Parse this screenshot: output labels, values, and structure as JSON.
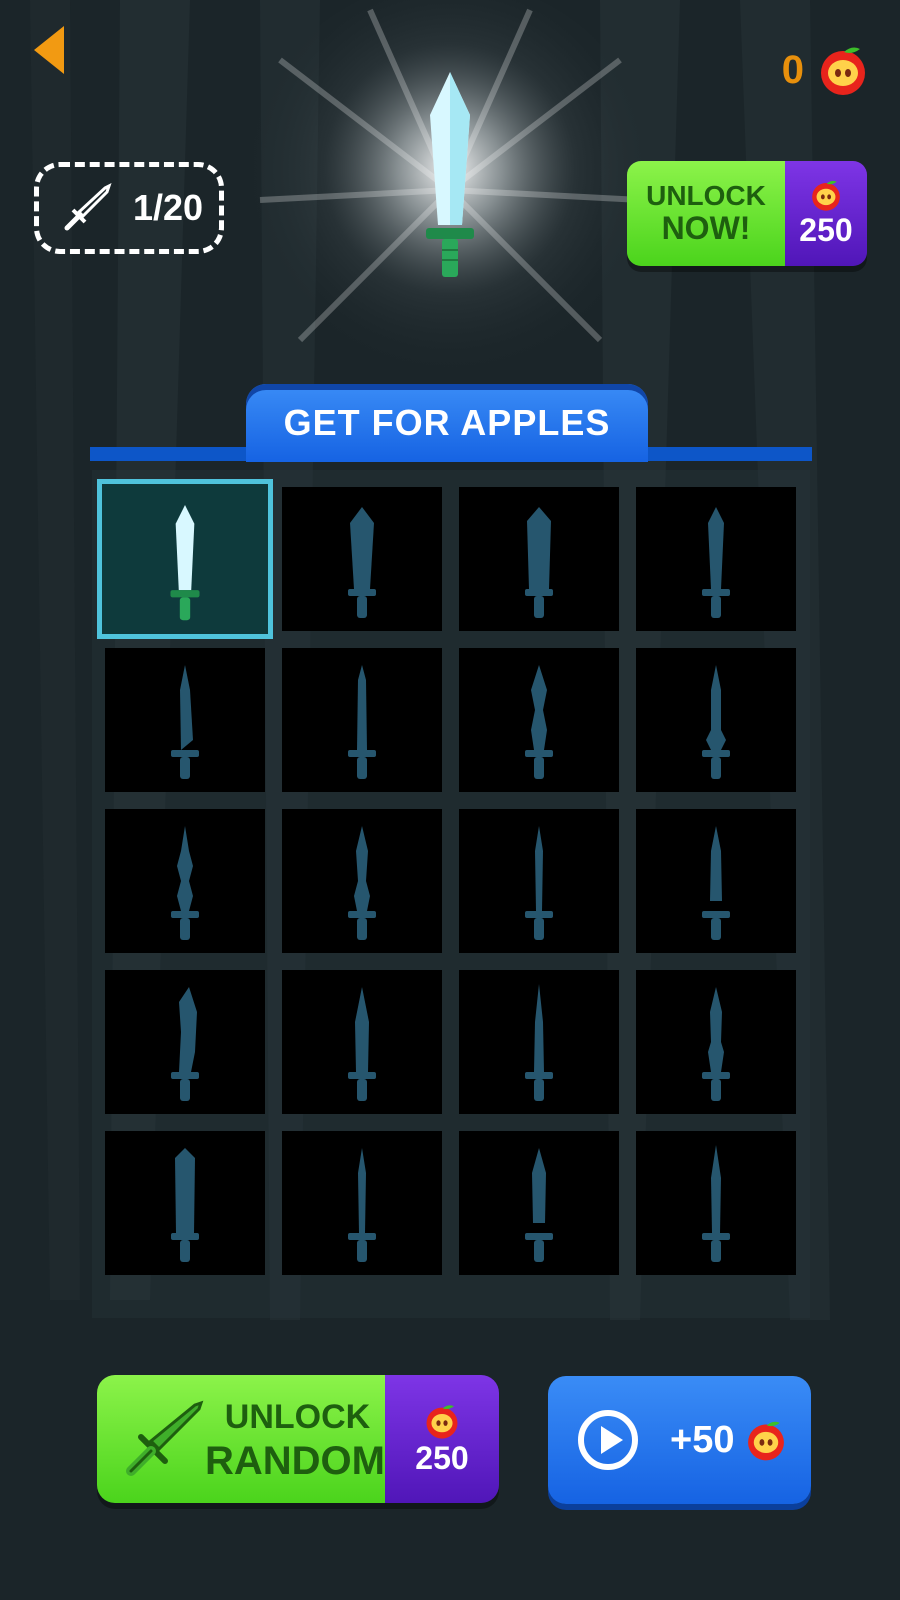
{
  "header": {
    "back_icon": "back-arrow-icon",
    "apple_count": "0",
    "apple_icon": "apple-icon"
  },
  "collection": {
    "progress_text": "1/20",
    "icon": "sword-icon"
  },
  "unlock_now": {
    "label_line1": "UNLOCK",
    "label_line2": "NOW!",
    "price": "250"
  },
  "section": {
    "title": "GET FOR APPLES"
  },
  "grid": {
    "selected_index": 0,
    "items": [
      {
        "type": "knife-classic",
        "unlocked": true
      },
      {
        "type": "knife-wide",
        "unlocked": false
      },
      {
        "type": "knife-cleaver",
        "unlocked": false
      },
      {
        "type": "knife-slim",
        "unlocked": false
      },
      {
        "type": "knife-curved-tip",
        "unlocked": false
      },
      {
        "type": "knife-serrated",
        "unlocked": false
      },
      {
        "type": "knife-diamond",
        "unlocked": false
      },
      {
        "type": "knife-bulb",
        "unlocked": false
      },
      {
        "type": "knife-ornate",
        "unlocked": false
      },
      {
        "type": "knife-dagger",
        "unlocked": false
      },
      {
        "type": "knife-saw",
        "unlocked": false
      },
      {
        "type": "knife-stiletto",
        "unlocked": false
      },
      {
        "type": "knife-scimitar",
        "unlocked": false
      },
      {
        "type": "knife-spike",
        "unlocked": false
      },
      {
        "type": "knife-needle",
        "unlocked": false
      },
      {
        "type": "knife-kris",
        "unlocked": false
      },
      {
        "type": "knife-broad",
        "unlocked": false
      },
      {
        "type": "knife-rapier",
        "unlocked": false
      },
      {
        "type": "knife-spear",
        "unlocked": false
      },
      {
        "type": "knife-thin",
        "unlocked": false
      }
    ]
  },
  "unlock_random": {
    "label_line1": "UNLOCK",
    "label_line2": "RANDOM",
    "price": "250"
  },
  "watch_ad": {
    "play_icon": "play-icon",
    "reward": "+50"
  },
  "colors": {
    "accent_orange": "#f29a12",
    "green_button": "#5bdc22",
    "purple_price": "#6424cc",
    "blue_button": "#1c6fe8",
    "selected_border": "#4fc3dc",
    "locked_silhouette": "#26566e"
  }
}
